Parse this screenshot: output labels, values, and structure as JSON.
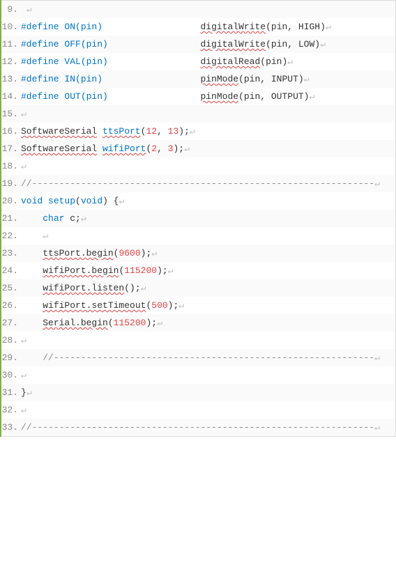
{
  "lines": [
    {
      "n": 9,
      "tokens": [
        {
          "t": " ",
          "c": ""
        },
        {
          "t": "↵",
          "c": "ret"
        }
      ]
    },
    {
      "n": 10,
      "tokens": [
        {
          "t": "#define ON(pin)",
          "c": "pre"
        },
        {
          "t": "                  ",
          "c": ""
        },
        {
          "t": "digitalWrite",
          "c": "squig"
        },
        {
          "t": "(pin, HIGH)",
          "c": ""
        },
        {
          "t": "↵",
          "c": "ret"
        }
      ]
    },
    {
      "n": 11,
      "tokens": [
        {
          "t": "#define OFF(pin)",
          "c": "pre"
        },
        {
          "t": "                 ",
          "c": ""
        },
        {
          "t": "digitalWrite",
          "c": "squig"
        },
        {
          "t": "(pin, LOW)",
          "c": ""
        },
        {
          "t": "↵",
          "c": "ret"
        }
      ]
    },
    {
      "n": 12,
      "tokens": [
        {
          "t": "#define VAL(pin)",
          "c": "pre"
        },
        {
          "t": "                 ",
          "c": ""
        },
        {
          "t": "digitalRead",
          "c": "squig"
        },
        {
          "t": "(pin)",
          "c": ""
        },
        {
          "t": "↵",
          "c": "ret"
        }
      ]
    },
    {
      "n": 13,
      "tokens": [
        {
          "t": "#define IN(pin)",
          "c": "pre"
        },
        {
          "t": "                  ",
          "c": ""
        },
        {
          "t": "pinMode",
          "c": "squig"
        },
        {
          "t": "(pin, INPUT)",
          "c": ""
        },
        {
          "t": "↵",
          "c": "ret"
        }
      ]
    },
    {
      "n": 14,
      "tokens": [
        {
          "t": "#define OUT(pin)",
          "c": "pre"
        },
        {
          "t": "                 ",
          "c": ""
        },
        {
          "t": "pinMode",
          "c": "squig"
        },
        {
          "t": "(pin, OUTPUT)",
          "c": ""
        },
        {
          "t": "↵",
          "c": "ret"
        }
      ]
    },
    {
      "n": 15,
      "tokens": [
        {
          "t": "↵",
          "c": "ret"
        }
      ]
    },
    {
      "n": 16,
      "tokens": [
        {
          "t": "SoftwareSerial",
          "c": "squig"
        },
        {
          "t": " ",
          "c": ""
        },
        {
          "t": "ttsPort",
          "c": "squig fn"
        },
        {
          "t": "(",
          "c": ""
        },
        {
          "t": "12",
          "c": "num"
        },
        {
          "t": ", ",
          "c": ""
        },
        {
          "t": "13",
          "c": "num"
        },
        {
          "t": ");",
          "c": ""
        },
        {
          "t": "↵",
          "c": "ret"
        }
      ]
    },
    {
      "n": 17,
      "tokens": [
        {
          "t": "SoftwareSerial",
          "c": "squig"
        },
        {
          "t": " ",
          "c": ""
        },
        {
          "t": "wifiPort",
          "c": "squig fn"
        },
        {
          "t": "(",
          "c": ""
        },
        {
          "t": "2",
          "c": "num"
        },
        {
          "t": ", ",
          "c": ""
        },
        {
          "t": "3",
          "c": "num"
        },
        {
          "t": ");",
          "c": ""
        },
        {
          "t": "↵",
          "c": "ret"
        }
      ]
    },
    {
      "n": 18,
      "tokens": [
        {
          "t": "↵",
          "c": "ret"
        }
      ]
    },
    {
      "n": 19,
      "tokens": [
        {
          "t": "//---------------------------------------------------------------",
          "c": "comment"
        },
        {
          "t": "↵",
          "c": "ret"
        }
      ]
    },
    {
      "n": 20,
      "tokens": [
        {
          "t": "void",
          "c": "kw"
        },
        {
          "t": " ",
          "c": ""
        },
        {
          "t": "setup",
          "c": "fn"
        },
        {
          "t": "(",
          "c": ""
        },
        {
          "t": "void",
          "c": "kw"
        },
        {
          "t": ") {",
          "c": ""
        },
        {
          "t": "↵",
          "c": "ret"
        }
      ]
    },
    {
      "n": 21,
      "tokens": [
        {
          "t": "    ",
          "c": ""
        },
        {
          "t": "char",
          "c": "kw"
        },
        {
          "t": " c;",
          "c": ""
        },
        {
          "t": "↵",
          "c": "ret"
        }
      ]
    },
    {
      "n": 22,
      "tokens": [
        {
          "t": "    ",
          "c": ""
        },
        {
          "t": "↵",
          "c": "ret"
        }
      ]
    },
    {
      "n": 23,
      "tokens": [
        {
          "t": "    ",
          "c": ""
        },
        {
          "t": "ttsPort.begin",
          "c": "squig"
        },
        {
          "t": "(",
          "c": ""
        },
        {
          "t": "9600",
          "c": "num"
        },
        {
          "t": ");",
          "c": ""
        },
        {
          "t": "↵",
          "c": "ret"
        }
      ]
    },
    {
      "n": 24,
      "tokens": [
        {
          "t": "    ",
          "c": ""
        },
        {
          "t": "wifiPort.begin",
          "c": "squig"
        },
        {
          "t": "(",
          "c": ""
        },
        {
          "t": "115200",
          "c": "num"
        },
        {
          "t": ");",
          "c": ""
        },
        {
          "t": "↵",
          "c": "ret"
        }
      ]
    },
    {
      "n": 25,
      "tokens": [
        {
          "t": "    ",
          "c": ""
        },
        {
          "t": "wifiPort.listen",
          "c": "squig"
        },
        {
          "t": "();",
          "c": ""
        },
        {
          "t": "↵",
          "c": "ret"
        }
      ]
    },
    {
      "n": 26,
      "tokens": [
        {
          "t": "    ",
          "c": ""
        },
        {
          "t": "wifiPort.setTimeout",
          "c": "squig"
        },
        {
          "t": "(",
          "c": ""
        },
        {
          "t": "500",
          "c": "num"
        },
        {
          "t": ");",
          "c": ""
        },
        {
          "t": "↵",
          "c": "ret"
        }
      ]
    },
    {
      "n": 27,
      "tokens": [
        {
          "t": "    ",
          "c": ""
        },
        {
          "t": "Serial.begin",
          "c": "squig"
        },
        {
          "t": "(",
          "c": ""
        },
        {
          "t": "115200",
          "c": "num"
        },
        {
          "t": ");",
          "c": ""
        },
        {
          "t": "↵",
          "c": "ret"
        }
      ]
    },
    {
      "n": 28,
      "tokens": [
        {
          "t": "↵",
          "c": "ret"
        }
      ]
    },
    {
      "n": 29,
      "tokens": [
        {
          "t": "    ",
          "c": ""
        },
        {
          "t": "//-----------------------------------------------------------",
          "c": "comment"
        },
        {
          "t": "↵",
          "c": "ret"
        }
      ]
    },
    {
      "n": 30,
      "tokens": [
        {
          "t": "↵",
          "c": "ret"
        }
      ]
    },
    {
      "n": 31,
      "tokens": [
        {
          "t": "}",
          "c": ""
        },
        {
          "t": "↵",
          "c": "ret"
        }
      ]
    },
    {
      "n": 32,
      "tokens": [
        {
          "t": "↵",
          "c": "ret"
        }
      ]
    },
    {
      "n": 33,
      "tokens": [
        {
          "t": "//---------------------------------------------------------------",
          "c": "comment"
        },
        {
          "t": "↵",
          "c": "ret"
        }
      ]
    }
  ]
}
